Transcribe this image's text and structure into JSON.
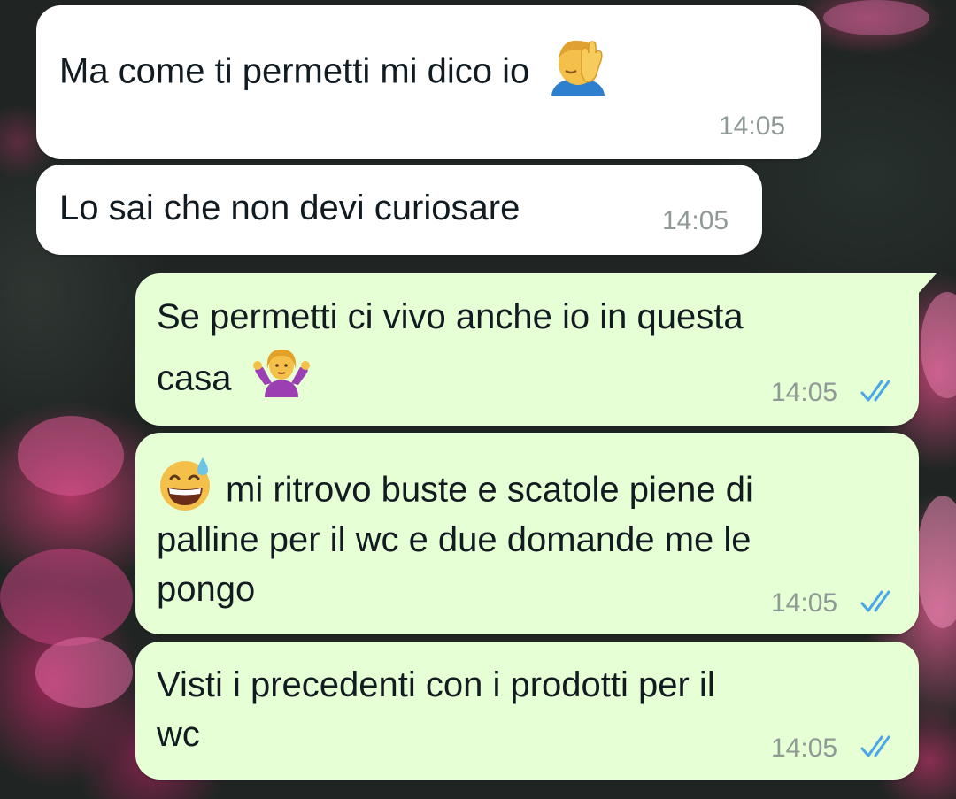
{
  "colors": {
    "incoming_bubble": "#ffffff",
    "outgoing_bubble": "#e6ffd4",
    "message_text": "#111b21",
    "timestamp": "#8f9a97",
    "read_ticks": "#4aa6e8"
  },
  "messages": [
    {
      "direction": "incoming",
      "text": "Ma come ti permetti mi dico io",
      "emoji_after": "face-palm-emoji",
      "time": "14:05"
    },
    {
      "direction": "incoming",
      "text": "Lo sai che non devi curiosare",
      "time": "14:05"
    },
    {
      "direction": "outgoing",
      "lines": [
        "Se permetti ci vivo anche io in questa",
        "casa"
      ],
      "emoji_after": "shrugging-woman-emoji",
      "time": "14:05",
      "status": "read-double-check-icon"
    },
    {
      "direction": "outgoing",
      "emoji_before": "grinning-sweat-emoji",
      "lines": [
        "mi ritrovo buste e scatole piene di",
        "palline per il wc e due domande me le",
        "pongo"
      ],
      "time": "14:05",
      "status": "read-double-check-icon"
    },
    {
      "direction": "outgoing",
      "lines": [
        "Visti i precedenti con i prodotti per il",
        "wc"
      ],
      "time": "14:05",
      "status": "read-double-check-icon"
    }
  ]
}
